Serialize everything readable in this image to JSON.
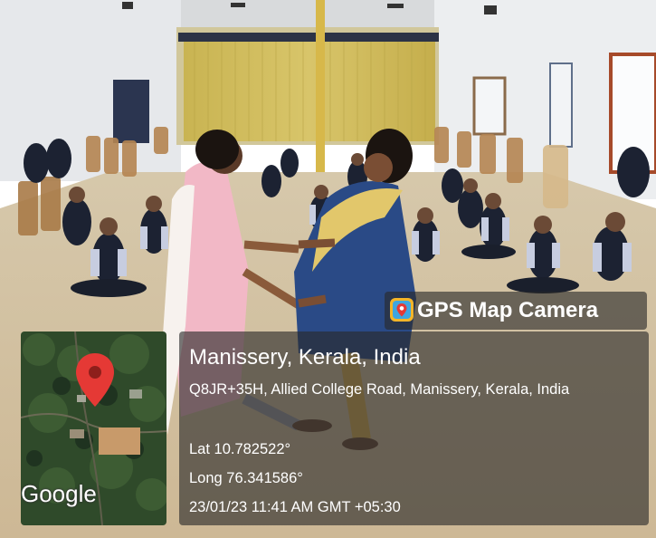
{
  "overlay": {
    "brand": {
      "icon": "map-camera-app-icon",
      "label": "GPS Map Camera"
    },
    "map": {
      "marker_icon": "map-pin-icon",
      "attribution": "Google"
    },
    "location": {
      "title": "Manissery, Kerala, India",
      "address": "Q8JR+35H, Allied College Road, Manissery, Kerala, India",
      "latitude": "Lat 10.782522°",
      "longitude": "Long 76.341586°",
      "timestamp": "23/01/23 11:41 AM GMT +05:30"
    }
  },
  "colors": {
    "panel": "#282828",
    "marker": "#e53935",
    "wall": "#e9eaec",
    "curtain": "#cdbb5a",
    "floor": "#d9c9a8",
    "uniform": "#1e2433"
  }
}
